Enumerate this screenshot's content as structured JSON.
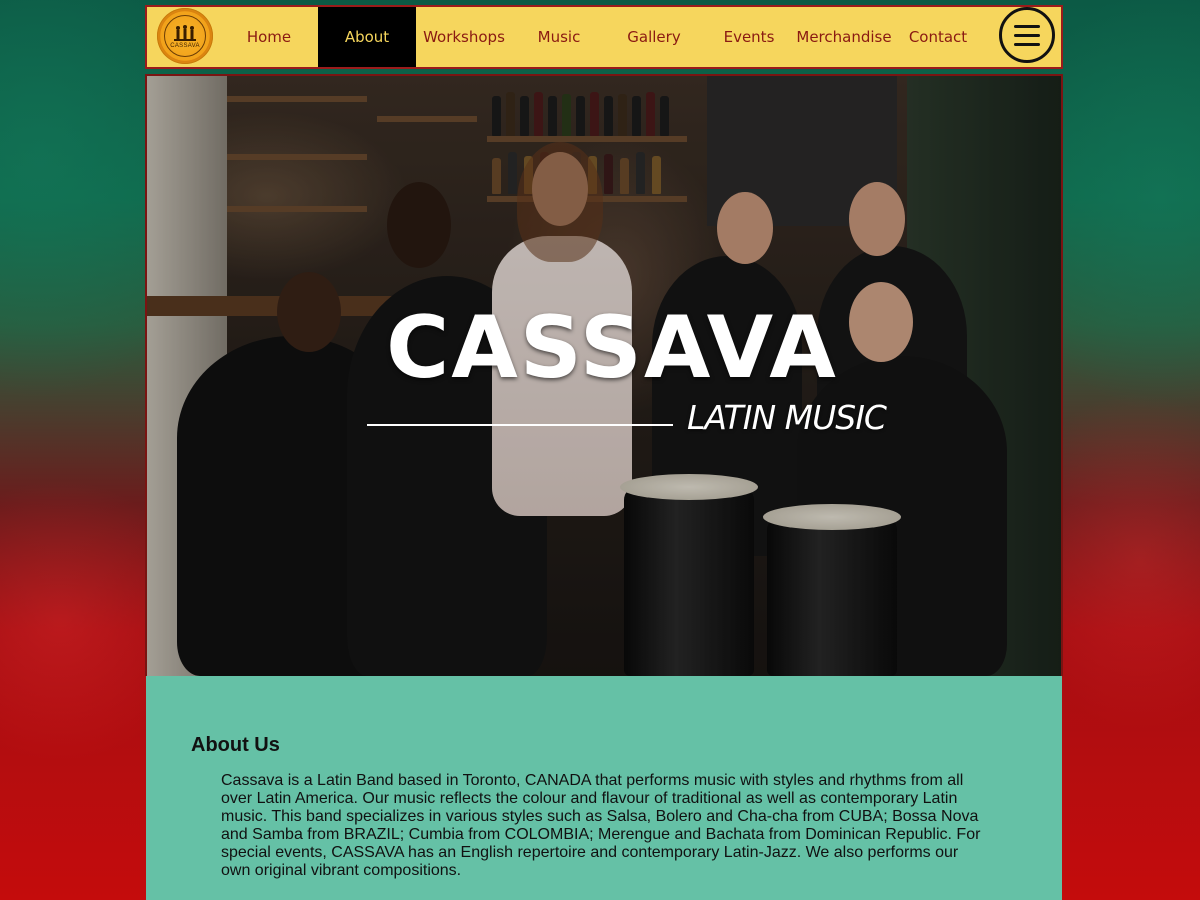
{
  "logo": {
    "text": "CASSAVA"
  },
  "nav": {
    "items": [
      {
        "label": "Home"
      },
      {
        "label": "About"
      },
      {
        "label": "Workshops"
      },
      {
        "label": "Music"
      },
      {
        "label": "Gallery"
      },
      {
        "label": "Events"
      },
      {
        "label": "Merchandise"
      },
      {
        "label": "Contact"
      }
    ],
    "active_index": 1,
    "menu_icon": "hamburger-icon"
  },
  "hero": {
    "title": "CASSAVA",
    "subtitle": "LATIN MUSIC"
  },
  "about": {
    "heading": "About Us",
    "body": "Cassava is a Latin Band based in Toronto, CANADA that performs music with styles and rhythms from all over Latin America. Our music reflects the colour and flavour of traditional as well as contemporary Latin music. This band specializes in various styles such as Salsa, Bolero and Cha-cha from CUBA; Bossa Nova and Samba from BRAZIL; Cumbia from COLOMBIA; Merengue and Bachata from Dominican Republic. For special events, CASSAVA has an English repertoire and contemporary Latin-Jazz. We also performs our own original vibrant compositions."
  },
  "colors": {
    "nav_bg": "#f6d65d",
    "nav_text": "#8a1a12",
    "nav_active_bg": "#000000",
    "nav_active_text": "#f6d65d",
    "border": "#9b1b1b",
    "about_bg": "#65c1a6"
  }
}
